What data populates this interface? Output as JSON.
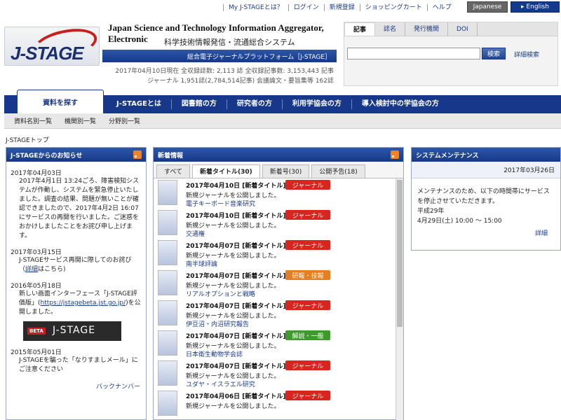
{
  "header": {
    "top_links": [
      "My J-STAGEとは？",
      "ログイン",
      "新規登録",
      "ショッピングカート",
      "ヘルプ"
    ],
    "lang_ja": "Japanese",
    "lang_en": "▸ English",
    "logo_text": "J-STAGE",
    "eng_title": "Japan Science and Technology Information Aggregator, Electronic",
    "jp_title": "科学技術情報発信・流通総合システム",
    "subtitle": "総合電子ジャーナルプラットフォーム［J-STAGE］",
    "stats_line1": "2017年04月10日現在 全収録誌数: 2,113 誌 全収録記事数: 3,153,443 記事",
    "stats_line2": "ジャーナル 1,951誌(2,784,514記事) 会議論文・要旨集等 162誌"
  },
  "search": {
    "tabs": [
      "記事",
      "誌名",
      "発行機関",
      "DOI"
    ],
    "button": "検索",
    "advanced": "詳細検索",
    "value": ""
  },
  "nav": {
    "active": "資料を探す",
    "items": [
      "J-STAGEとは",
      "図書館の方",
      "研究者の方",
      "利用学協会の方",
      "導入検討中の学協会の方"
    ],
    "sub": [
      "資料名別一覧",
      "機関別一覧",
      "分野別一覧"
    ]
  },
  "breadcrumb": "J-STAGEトップ",
  "notices": {
    "title": "J-STAGEからのお知らせ",
    "items": [
      {
        "date": "2017年04月03日",
        "text": "2017年4月1日 13:24ごろ、障害検知システムが作動し、システムを緊急停止いたしました。調査の結果、問題が無いことが確認できましたので、2017年4月2日 16:07にサービスの再開を行いました。ご迷惑をおかけしましたことをお詫び申し上げます。"
      },
      {
        "date": "2017年03月15日",
        "text_a": "J-STAGEサービス再開に際してのお詫び（",
        "link": "詳細",
        "text_b": "はこちら)"
      },
      {
        "date": "2016年05月18日",
        "text_a": "新しい画面インターフェース「J-STAGE評価版」(",
        "link": "https://jstagebeta.jst.go.jp/",
        "text_b": ")を公開しました。"
      },
      {
        "date": "2015年05月01日",
        "text": "J-STAGEを騙った「なりすましメール」にご注意ください"
      }
    ],
    "beta_badge": "BETA",
    "beta_text": "J-STAGE",
    "backnumber": "バックナンバー"
  },
  "whatsnew": {
    "title": "新着情報",
    "tabs": [
      "すべて",
      "新着タイトル(30)",
      "新着号(30)",
      "公開予告(18)"
    ],
    "items": [
      {
        "date": "2017年04月10日 [新着タイトル]",
        "badge": "ジャーナル",
        "color": "#d8261f",
        "desc": "新規ジャーナルを公開しました。",
        "link": "電子キーボード音楽研究"
      },
      {
        "date": "2017年04月10日 [新着タイトル]",
        "badge": "ジャーナル",
        "color": "#d8261f",
        "desc": "新規ジャーナルを公開しました。",
        "link": "交通権"
      },
      {
        "date": "2017年04月07日 [新着タイトル]",
        "badge": "ジャーナル",
        "color": "#d8261f",
        "desc": "新規ジャーナルを公開しました。",
        "link": "南半球評論"
      },
      {
        "date": "2017年04月07日 [新着タイトル]",
        "badge": "研報・技報",
        "color": "#e67e22",
        "desc": "新規ジャーナルを公開しました。",
        "link": "リアルオプションと戦略"
      },
      {
        "date": "2017年04月07日 [新着タイトル]",
        "badge": "ジャーナル",
        "color": "#d8261f",
        "desc": "新規ジャーナルを公開しました。",
        "link": "伊豆沼・内沼研究報告"
      },
      {
        "date": "2017年04月07日 [新着タイトル]",
        "badge": "解説・一般",
        "color": "#3f9a2e",
        "desc": "新規ジャーナルを公開しました。",
        "link": "日本衛生動物学会誌"
      },
      {
        "date": "2017年04月07日 [新着タイトル]",
        "badge": "ジャーナル",
        "color": "#d8261f",
        "desc": "新規ジャーナルを公開しました。",
        "link": "ユダヤ・イスラエル研究"
      },
      {
        "date": "2017年04月06日 [新着タイトル]",
        "badge": "ジャーナル",
        "color": "#d8261f",
        "desc": "新規ジャーナルを公開しました。",
        "link": ""
      }
    ]
  },
  "maintenance": {
    "title": "システムメンテナンス",
    "date": "2017年03月26日",
    "line1": "メンテナンスのため、以下の時間帯にサービスを停止させていただきます。",
    "line2": "平成29年",
    "line3": "4月29日(土) 10:00 〜 15:00",
    "more": "詳細"
  }
}
